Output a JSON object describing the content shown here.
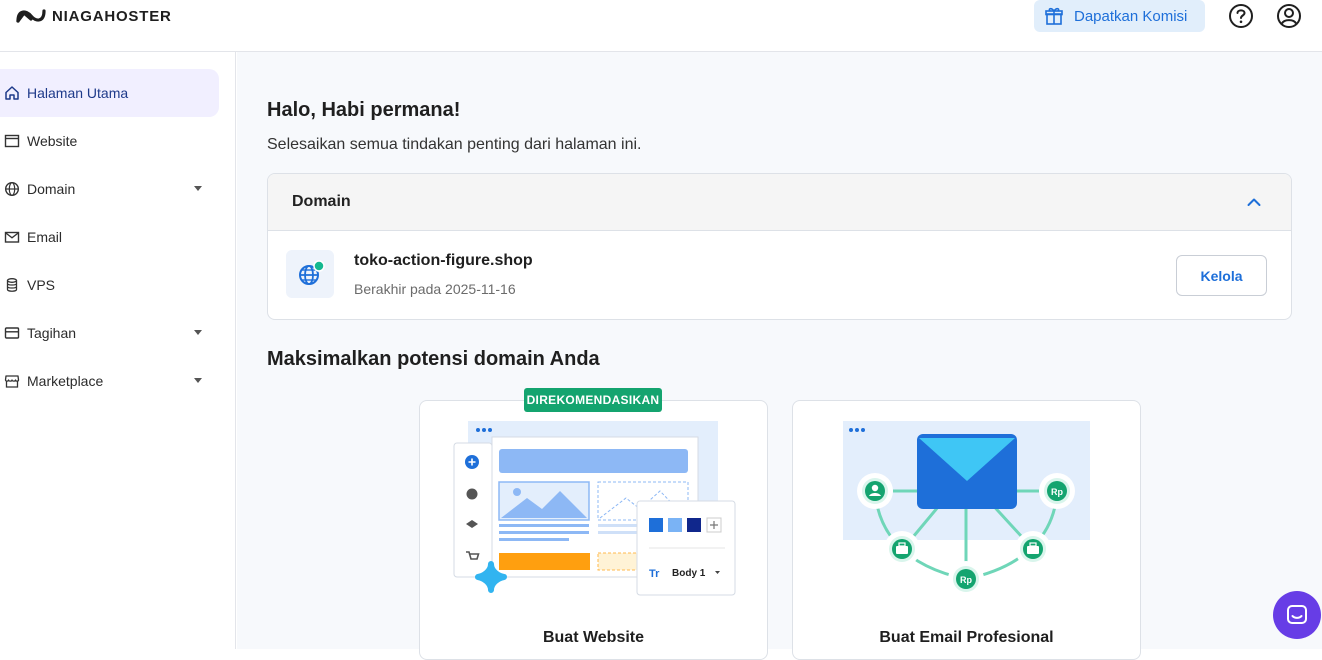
{
  "brand": {
    "name": "NIAGAHOSTER"
  },
  "topbar": {
    "komisi_label": "Dapatkan Komisi"
  },
  "sidebar": {
    "items": [
      {
        "label": "Halaman Utama",
        "icon": "home-icon",
        "active": true
      },
      {
        "label": "Website",
        "icon": "browser-window-icon"
      },
      {
        "label": "Domain",
        "icon": "globe-icon",
        "has_caret": true
      },
      {
        "label": "Email",
        "icon": "mail-icon"
      },
      {
        "label": "VPS",
        "icon": "database-icon"
      },
      {
        "label": "Tagihan",
        "icon": "credit-card-icon",
        "has_caret": true
      },
      {
        "label": "Marketplace",
        "icon": "store-icon",
        "has_caret": true
      }
    ]
  },
  "main": {
    "greeting": "Halo, Habi permana!",
    "subtitle": "Selesaikan semua tindakan penting dari halaman ini.",
    "domain_card": {
      "title": "Domain",
      "domain_name": "toko-action-figure.shop",
      "expiry": "Berakhir pada 2025-11-16",
      "manage_label": "Kelola"
    },
    "section_title": "Maksimalkan potensi domain Anda",
    "promos": [
      {
        "title": "Buat Website",
        "badge": "DIREKOMENDASIKAN",
        "style_label": "Body 1",
        "style_icon_label": "Tr"
      },
      {
        "title": "Buat Email Profesional",
        "currency_label": "Rp"
      }
    ]
  },
  "colors": {
    "accent": "#1e6fd9",
    "active_bg": "#f1efff",
    "badge_green": "#14a46f",
    "chat_purple": "#673de6"
  }
}
